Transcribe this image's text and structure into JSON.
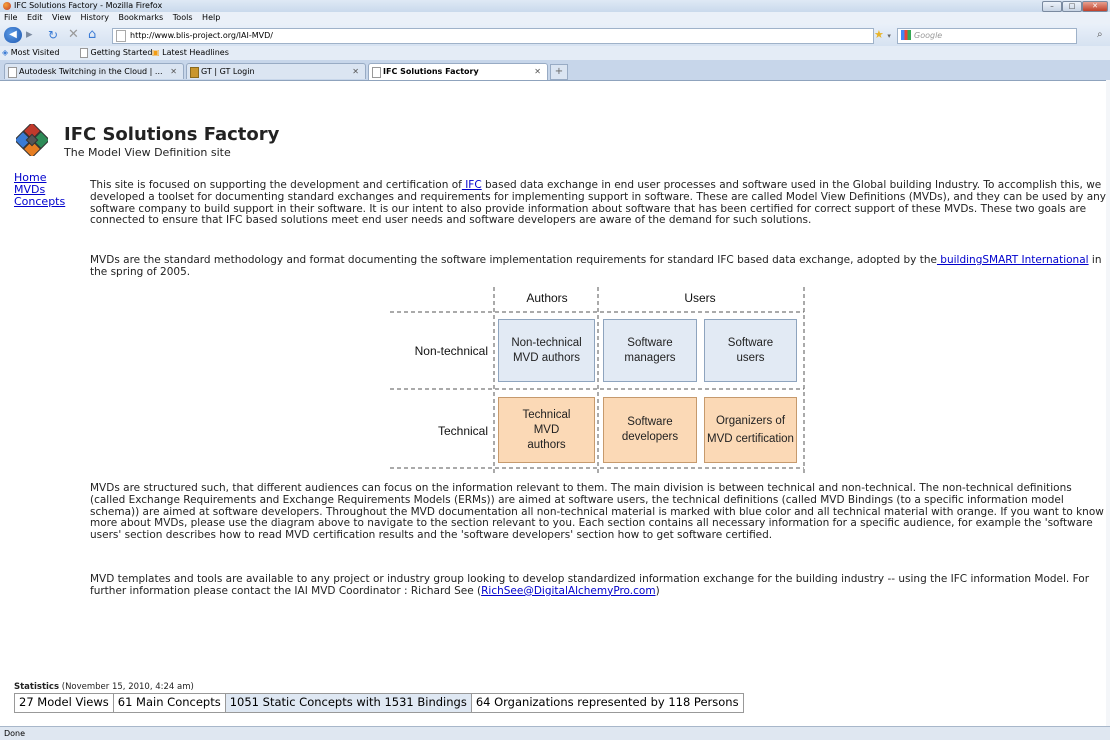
{
  "window": {
    "title": "IFC Solutions Factory - Mozilla Firefox"
  },
  "menu": [
    "File",
    "Edit",
    "View",
    "History",
    "Bookmarks",
    "Tools",
    "Help"
  ],
  "address_bar": {
    "url": "http://www.blis-project.org/IAI-MVD/",
    "search_placeholder": "Google"
  },
  "bookmarks": [
    "Most Visited",
    "Getting Started",
    "Latest Headlines"
  ],
  "tabs": [
    {
      "label": "Autodesk Twitching in the Cloud | ..."
    },
    {
      "label": "GT | GT Login"
    },
    {
      "label": "IFC Solutions Factory",
      "active": true
    }
  ],
  "page": {
    "title": "IFC Solutions Factory",
    "subtitle": "The Model View Definition site",
    "nav": [
      "Home",
      "MVDs",
      "Concepts"
    ],
    "para1": {
      "t1": "This site is focused on supporting the development and certification of",
      "link": " IFC",
      "t2": " based data exchange in end user processes and software used in the Global building Industry. To accomplish this, we developed a toolset for documenting standard exchanges and requirements for implementing support in software.  These are called Model View Definitions (MVDs), and they can be used by any software company to build support in their software.  It is our intent to also provide information about software that has been certified for correct support of these MVDs. These two goals are connected to ensure that IFC based solutions meet end user needs and software developers are aware of the demand for such solutions."
    },
    "para2": {
      "t1": "MVDs are the standard methodology and format documenting the software implementation requirements for standard IFC based data exchange, adopted by the",
      "link": " buildingSMART International",
      "t2": " in the spring of 2005."
    },
    "diagram": {
      "col_authors": "Authors",
      "col_users": "Users",
      "row_nontech": "Non-technical",
      "row_tech": "Technical",
      "nontech_authors": "Non-technical MVD authors",
      "software_managers": "Software managers",
      "software_users": "Software users",
      "tech_authors": "Technical MVD authors",
      "software_developers": "Software developers",
      "organizers": "Organizers of MVD certification",
      "color_blue": "#e2eaf4",
      "color_orange": "#fbd9b6"
    },
    "para3": "MVDs are structured such, that different audiences can focus on the information relevant to them. The main division is between technical and non-technical. The non-technical definitions (called Exchange Requirements and Exchange Requirements Models (ERMs)) are aimed at software users, the technical definitions (called MVD Bindings (to a specific information model schema)) are aimed at software developers. Throughout the MVD documentation all non-technical material is marked with blue color and all technical material with orange. If you want to know more about MVDs, please use the diagram above to navigate to the section relevant to you. Each section contains all necessary information for a specific audience, for example the 'software users' section describes how to read MVD certification results and the 'software developers' section how to get software certified.",
    "para4": {
      "t1": "MVD templates and tools are available to any project or industry group looking to develop standardized information exchange for the building industry -- using the IFC information Model. For further information please contact the IAI MVD Coordinator : Richard See (",
      "link": "RichSee@DigitalAlchemyPro.com",
      "t2": ")"
    },
    "stats": {
      "label": "Statistics",
      "date": "(November 15, 2010, 4:24 am)",
      "items": [
        "27 Model Views",
        "61 Main Concepts",
        "1051 Static Concepts with 1531 Bindings",
        "64 Organizations represented by 118 Persons"
      ]
    }
  },
  "status": "Done"
}
